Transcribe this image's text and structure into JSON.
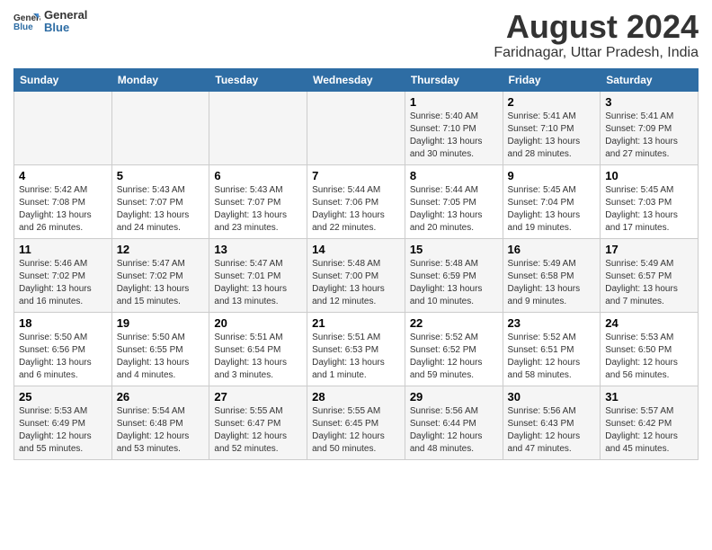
{
  "header": {
    "logo_general": "General",
    "logo_blue": "Blue",
    "main_title": "August 2024",
    "sub_title": "Faridnagar, Uttar Pradesh, India"
  },
  "days_of_week": [
    "Sunday",
    "Monday",
    "Tuesday",
    "Wednesday",
    "Thursday",
    "Friday",
    "Saturday"
  ],
  "weeks": [
    {
      "days": [
        {
          "number": "",
          "info": ""
        },
        {
          "number": "",
          "info": ""
        },
        {
          "number": "",
          "info": ""
        },
        {
          "number": "",
          "info": ""
        },
        {
          "number": "1",
          "info": "Sunrise: 5:40 AM\nSunset: 7:10 PM\nDaylight: 13 hours\nand 30 minutes."
        },
        {
          "number": "2",
          "info": "Sunrise: 5:41 AM\nSunset: 7:10 PM\nDaylight: 13 hours\nand 28 minutes."
        },
        {
          "number": "3",
          "info": "Sunrise: 5:41 AM\nSunset: 7:09 PM\nDaylight: 13 hours\nand 27 minutes."
        }
      ]
    },
    {
      "days": [
        {
          "number": "4",
          "info": "Sunrise: 5:42 AM\nSunset: 7:08 PM\nDaylight: 13 hours\nand 26 minutes."
        },
        {
          "number": "5",
          "info": "Sunrise: 5:43 AM\nSunset: 7:07 PM\nDaylight: 13 hours\nand 24 minutes."
        },
        {
          "number": "6",
          "info": "Sunrise: 5:43 AM\nSunset: 7:07 PM\nDaylight: 13 hours\nand 23 minutes."
        },
        {
          "number": "7",
          "info": "Sunrise: 5:44 AM\nSunset: 7:06 PM\nDaylight: 13 hours\nand 22 minutes."
        },
        {
          "number": "8",
          "info": "Sunrise: 5:44 AM\nSunset: 7:05 PM\nDaylight: 13 hours\nand 20 minutes."
        },
        {
          "number": "9",
          "info": "Sunrise: 5:45 AM\nSunset: 7:04 PM\nDaylight: 13 hours\nand 19 minutes."
        },
        {
          "number": "10",
          "info": "Sunrise: 5:45 AM\nSunset: 7:03 PM\nDaylight: 13 hours\nand 17 minutes."
        }
      ]
    },
    {
      "days": [
        {
          "number": "11",
          "info": "Sunrise: 5:46 AM\nSunset: 7:02 PM\nDaylight: 13 hours\nand 16 minutes."
        },
        {
          "number": "12",
          "info": "Sunrise: 5:47 AM\nSunset: 7:02 PM\nDaylight: 13 hours\nand 15 minutes."
        },
        {
          "number": "13",
          "info": "Sunrise: 5:47 AM\nSunset: 7:01 PM\nDaylight: 13 hours\nand 13 minutes."
        },
        {
          "number": "14",
          "info": "Sunrise: 5:48 AM\nSunset: 7:00 PM\nDaylight: 13 hours\nand 12 minutes."
        },
        {
          "number": "15",
          "info": "Sunrise: 5:48 AM\nSunset: 6:59 PM\nDaylight: 13 hours\nand 10 minutes."
        },
        {
          "number": "16",
          "info": "Sunrise: 5:49 AM\nSunset: 6:58 PM\nDaylight: 13 hours\nand 9 minutes."
        },
        {
          "number": "17",
          "info": "Sunrise: 5:49 AM\nSunset: 6:57 PM\nDaylight: 13 hours\nand 7 minutes."
        }
      ]
    },
    {
      "days": [
        {
          "number": "18",
          "info": "Sunrise: 5:50 AM\nSunset: 6:56 PM\nDaylight: 13 hours\nand 6 minutes."
        },
        {
          "number": "19",
          "info": "Sunrise: 5:50 AM\nSunset: 6:55 PM\nDaylight: 13 hours\nand 4 minutes."
        },
        {
          "number": "20",
          "info": "Sunrise: 5:51 AM\nSunset: 6:54 PM\nDaylight: 13 hours\nand 3 minutes."
        },
        {
          "number": "21",
          "info": "Sunrise: 5:51 AM\nSunset: 6:53 PM\nDaylight: 13 hours\nand 1 minute."
        },
        {
          "number": "22",
          "info": "Sunrise: 5:52 AM\nSunset: 6:52 PM\nDaylight: 12 hours\nand 59 minutes."
        },
        {
          "number": "23",
          "info": "Sunrise: 5:52 AM\nSunset: 6:51 PM\nDaylight: 12 hours\nand 58 minutes."
        },
        {
          "number": "24",
          "info": "Sunrise: 5:53 AM\nSunset: 6:50 PM\nDaylight: 12 hours\nand 56 minutes."
        }
      ]
    },
    {
      "days": [
        {
          "number": "25",
          "info": "Sunrise: 5:53 AM\nSunset: 6:49 PM\nDaylight: 12 hours\nand 55 minutes."
        },
        {
          "number": "26",
          "info": "Sunrise: 5:54 AM\nSunset: 6:48 PM\nDaylight: 12 hours\nand 53 minutes."
        },
        {
          "number": "27",
          "info": "Sunrise: 5:55 AM\nSunset: 6:47 PM\nDaylight: 12 hours\nand 52 minutes."
        },
        {
          "number": "28",
          "info": "Sunrise: 5:55 AM\nSunset: 6:45 PM\nDaylight: 12 hours\nand 50 minutes."
        },
        {
          "number": "29",
          "info": "Sunrise: 5:56 AM\nSunset: 6:44 PM\nDaylight: 12 hours\nand 48 minutes."
        },
        {
          "number": "30",
          "info": "Sunrise: 5:56 AM\nSunset: 6:43 PM\nDaylight: 12 hours\nand 47 minutes."
        },
        {
          "number": "31",
          "info": "Sunrise: 5:57 AM\nSunset: 6:42 PM\nDaylight: 12 hours\nand 45 minutes."
        }
      ]
    }
  ]
}
